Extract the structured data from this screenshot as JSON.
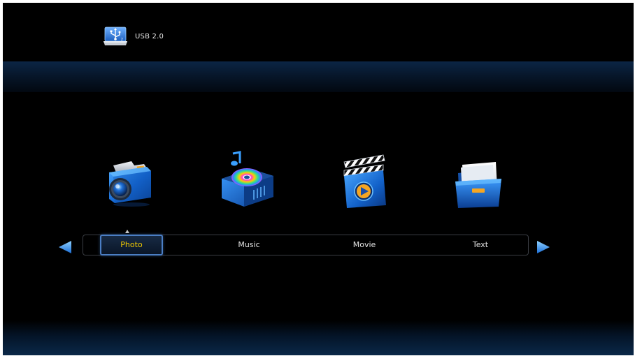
{
  "header": {
    "source_label": "USB 2.0",
    "source_icon": "usb-drive-icon"
  },
  "menu": {
    "selected_index": 0,
    "items": [
      {
        "label": "Photo",
        "icon": "camera-icon"
      },
      {
        "label": "Music",
        "icon": "music-disc-icon"
      },
      {
        "label": "Movie",
        "icon": "movie-clapperboard-icon"
      },
      {
        "label": "Text",
        "icon": "document-folder-icon"
      }
    ]
  },
  "navigation": {
    "prev_icon": "arrow-left-icon",
    "next_icon": "arrow-right-icon"
  },
  "colors": {
    "background": "#000000",
    "accent_blue": "#2a78d8",
    "selected_text": "#f0c800",
    "menu_text": "#e2e2e2"
  }
}
